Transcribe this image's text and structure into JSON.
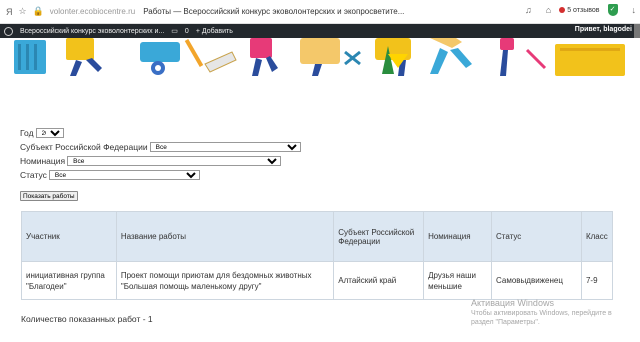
{
  "browser": {
    "url": "volonter.ecobiocentre.ru",
    "tab_title": "Работы — Всероссийский конкурс эковолонтерских и экопросветите...",
    "reviews": "5 отзывов"
  },
  "admin_bar": {
    "site_name": "Всероссийский конкурс эковолонтерских и...",
    "comments": "0",
    "add": "Добавить",
    "greeting": "Привет, blagodei"
  },
  "filters": {
    "year_label": "Год",
    "year_value": "2021",
    "region_label": "Субъект Российской Федерации",
    "region_value": "Все",
    "nomination_label": "Номинация",
    "nomination_value": "Все",
    "status_label": "Статус",
    "status_value": "Все",
    "show_button": "Показать работы"
  },
  "table": {
    "headers": [
      "Участник",
      "Название работы",
      "Субъект Российской Федерации",
      "Номинация",
      "Статус",
      "Класс"
    ],
    "rows": [
      [
        "инициативная группа \"Благодеи\"",
        "Проект помощи приютам для бездомных животных \"Большая помощь маленькому другу\"",
        "Алтайский край",
        "Друзья наши меньшие",
        "Самовыдвиженец",
        "7-9"
      ]
    ]
  },
  "count_text": "Количество показанных работ - 1",
  "watermark": {
    "title": "Активация Windows",
    "text": "Чтобы активировать Windows, перейдите в раздел \"Параметры\"."
  }
}
